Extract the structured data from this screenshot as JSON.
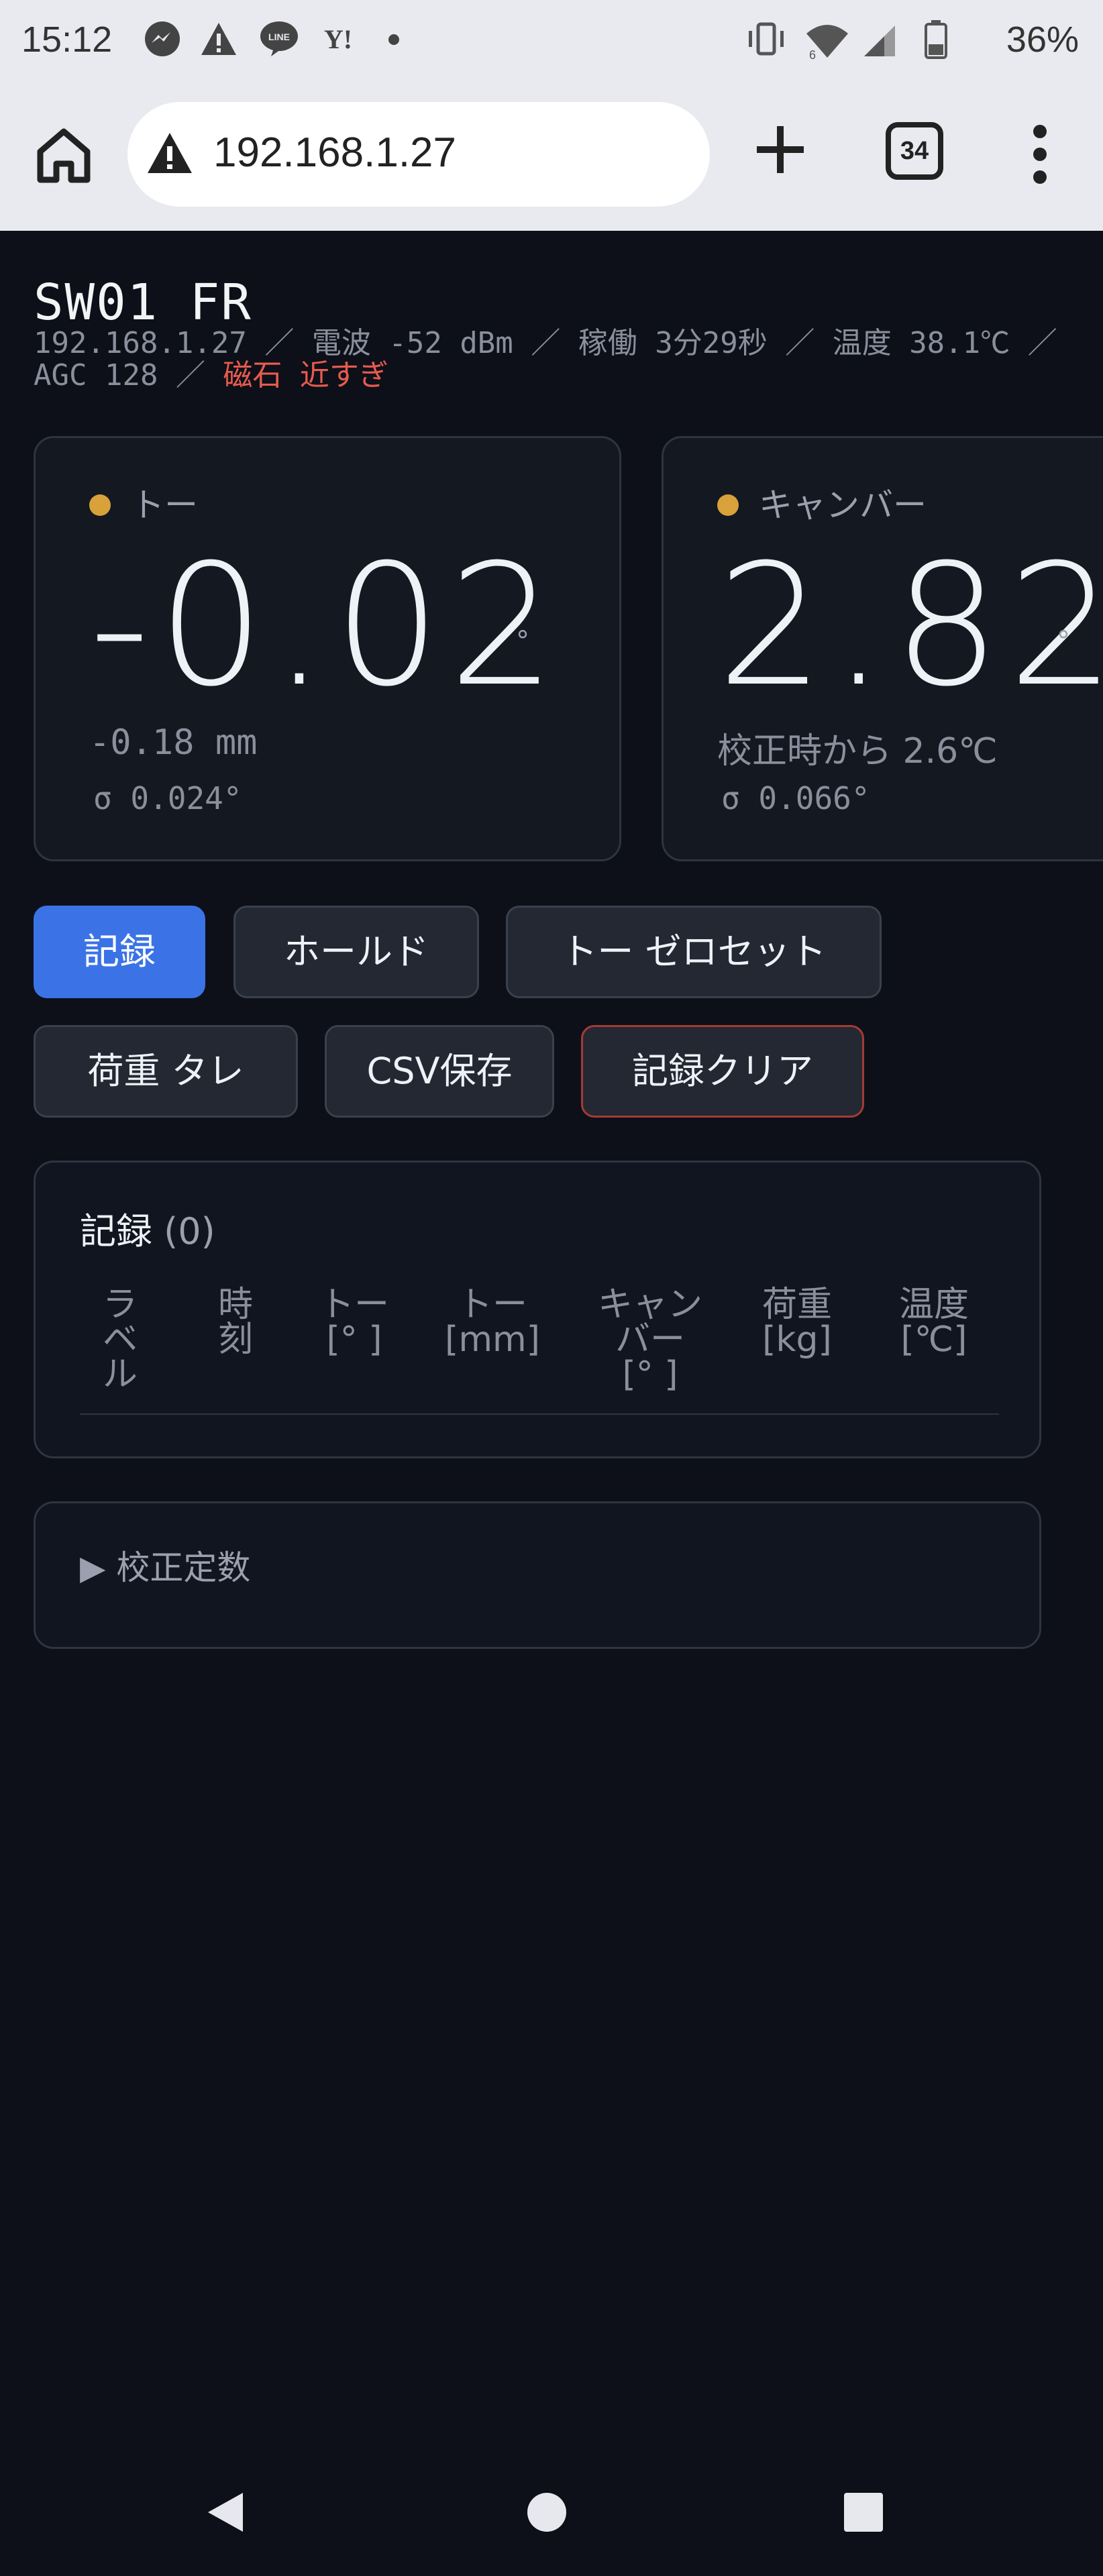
{
  "status_bar": {
    "time": "15:12",
    "notification_icons": [
      "messenger-icon",
      "alert-icon",
      "line-icon",
      "yahoo-icon",
      "dot-icon"
    ],
    "battery": "36%",
    "system_icons": [
      "vibrate-icon",
      "wifi-icon",
      "signal-icon",
      "battery-icon"
    ]
  },
  "browser": {
    "url": "192.168.1.27",
    "tab_count": "34"
  },
  "device": {
    "title": "SW01 FR",
    "info": "192.168.1.27 ／ 電波 -52 dBm ／ 稼働 3分29秒 ／ 温度 38.1℃ ／ AGC 128 ／ ",
    "warning": "磁石 近すぎ"
  },
  "toe": {
    "label": "トー",
    "value": "-0.02",
    "unit": "°",
    "sub1": "-0.18 mm",
    "sub2": "σ 0.024°"
  },
  "camber": {
    "label": "キャンバー",
    "value": "2.82",
    "unit": "°",
    "sub1": "校正時から 2.6℃",
    "sub2": "σ 0.066°"
  },
  "actions": {
    "record": "記録",
    "hold": "ホールド",
    "toe_zero": "トー ゼロセット",
    "load_sag": "荷重 タレ",
    "csv_save": "CSV保存",
    "clear": "記録クリア"
  },
  "records": {
    "title": "記録",
    "count": "(0)",
    "columns": [
      "ラ\nベ\nル",
      "時\n刻",
      "トー\n[° ]",
      "トー\n[mm]",
      "キャン\nバー\n[° ]",
      "荷重\n[kg]",
      "温度\n[℃]"
    ]
  },
  "calibration": {
    "summary": "▶ 校正定数"
  },
  "colors": {
    "background": "#0d1018",
    "accent": "#3b73e6",
    "indicator": "#d9a13a",
    "warning": "#e85a4f"
  }
}
